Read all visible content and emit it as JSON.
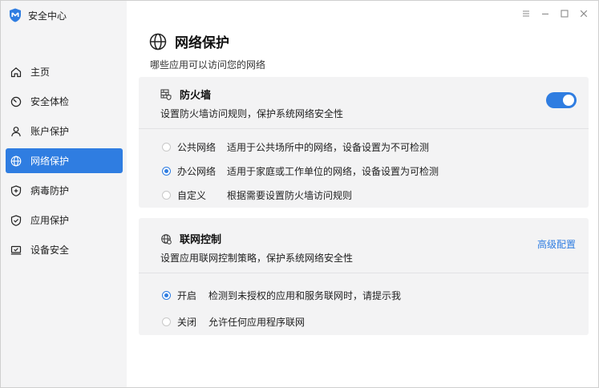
{
  "app": {
    "title": "安全中心",
    "logo_icon": "shield-logo-icon"
  },
  "window_controls": [
    {
      "name": "menu-icon",
      "glyph": "≡"
    },
    {
      "name": "minimize-icon",
      "glyph": "—"
    },
    {
      "name": "maximize-icon",
      "glyph": "□"
    },
    {
      "name": "close-icon",
      "glyph": "✕"
    }
  ],
  "sidebar": {
    "items": [
      {
        "label": "主页",
        "icon": "home-icon",
        "active": false
      },
      {
        "label": "安全体检",
        "icon": "gauge-icon",
        "active": false
      },
      {
        "label": "账户保护",
        "icon": "user-icon",
        "active": false
      },
      {
        "label": "网络保护",
        "icon": "globe-icon",
        "active": true
      },
      {
        "label": "病毒防护",
        "icon": "shield-plus-icon",
        "active": false
      },
      {
        "label": "应用保护",
        "icon": "shield-check-icon",
        "active": false
      },
      {
        "label": "设备安全",
        "icon": "laptop-check-icon",
        "active": false
      }
    ]
  },
  "page": {
    "title": "网络保护",
    "subtitle": "哪些应用可以访问您的网络",
    "icon": "globe-icon"
  },
  "firewall": {
    "title": "防火墙",
    "desc": "设置防火墙访问规则，保护系统网络安全性",
    "icon": "firewall-icon",
    "enabled": true,
    "options": [
      {
        "label": "公共网络",
        "desc": "适用于公共场所中的网络，设备设置为不可检测",
        "checked": false
      },
      {
        "label": "办公网络",
        "desc": "适用于家庭或工作单位的网络，设备设置为可检测",
        "checked": true
      },
      {
        "label": "自定义",
        "desc": "根据需要设置防火墙访问规则",
        "checked": false
      }
    ]
  },
  "network_control": {
    "title": "联网控制",
    "desc": "设置应用联网控制策略，保护系统网络安全性",
    "icon": "network-control-icon",
    "advanced_label": "高级配置",
    "options": [
      {
        "label": "开启",
        "desc": "检测到未授权的应用和服务联网时，请提示我",
        "checked": true
      },
      {
        "label": "关闭",
        "desc": "允许任何应用程序联网",
        "checked": false
      }
    ]
  },
  "colors": {
    "accent": "#2f7de1",
    "sidebar_bg": "#f4f4f5",
    "card_bg": "#f3f3f4"
  }
}
